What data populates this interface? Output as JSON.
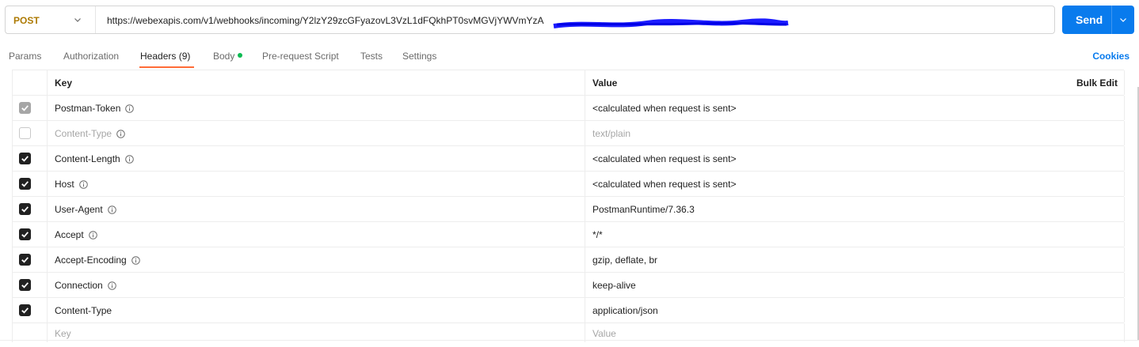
{
  "request": {
    "method": "POST",
    "url": "https://webexapis.com/v1/webhooks/incoming/Y2lzY29zcGFyazovL3VzL1dFQkhPT0svMGVjYWVmYzA",
    "send_label": "Send"
  },
  "tabs": [
    {
      "label": "Params",
      "active": false
    },
    {
      "label": "Authorization",
      "active": false
    },
    {
      "label": "Headers (9)",
      "active": true
    },
    {
      "label": "Body",
      "active": false
    },
    {
      "label": "Pre-request Script",
      "active": false
    },
    {
      "label": "Tests",
      "active": false
    },
    {
      "label": "Settings",
      "active": false
    }
  ],
  "cookies_label": "Cookies",
  "table": {
    "columns": {
      "key": "Key",
      "value": "Value",
      "bulk_edit": "Bulk Edit"
    },
    "rows": [
      {
        "key": "Postman-Token",
        "value": "<calculated when request is sent>",
        "state": "disabled-checked",
        "info": true
      },
      {
        "key": "Content-Type",
        "value": "text/plain",
        "state": "unchecked",
        "info": true
      },
      {
        "key": "Content-Length",
        "value": "<calculated when request is sent>",
        "state": "checked",
        "info": true
      },
      {
        "key": "Host",
        "value": "<calculated when request is sent>",
        "state": "checked",
        "info": true
      },
      {
        "key": "User-Agent",
        "value": "PostmanRuntime/7.36.3",
        "state": "checked",
        "info": true
      },
      {
        "key": "Accept",
        "value": "*/*",
        "state": "checked",
        "info": true
      },
      {
        "key": "Accept-Encoding",
        "value": "gzip, deflate, br",
        "state": "checked",
        "info": true
      },
      {
        "key": "Connection",
        "value": "keep-alive",
        "state": "checked",
        "info": true
      },
      {
        "key": "Content-Type",
        "value": "application/json",
        "state": "checked",
        "info": false
      }
    ],
    "placeholder": {
      "key": "Key",
      "value": "Value"
    }
  },
  "colors": {
    "accent": "#097bed",
    "method": "#ad7a03",
    "tab_underline": "#ff6c37",
    "body_dot": "#0cbb52"
  }
}
